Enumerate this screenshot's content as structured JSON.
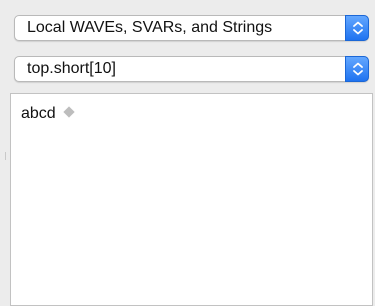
{
  "popups": [
    {
      "value": "Local WAVEs, SVARs, and Strings"
    },
    {
      "value": "top.short[10]"
    }
  ],
  "list": {
    "items": [
      {
        "label": "abcd"
      }
    ]
  },
  "colors": {
    "window_bg": "#ececec",
    "stepper_blue": "#2b7ff3",
    "diamond_gray": "#bdbdbd"
  }
}
